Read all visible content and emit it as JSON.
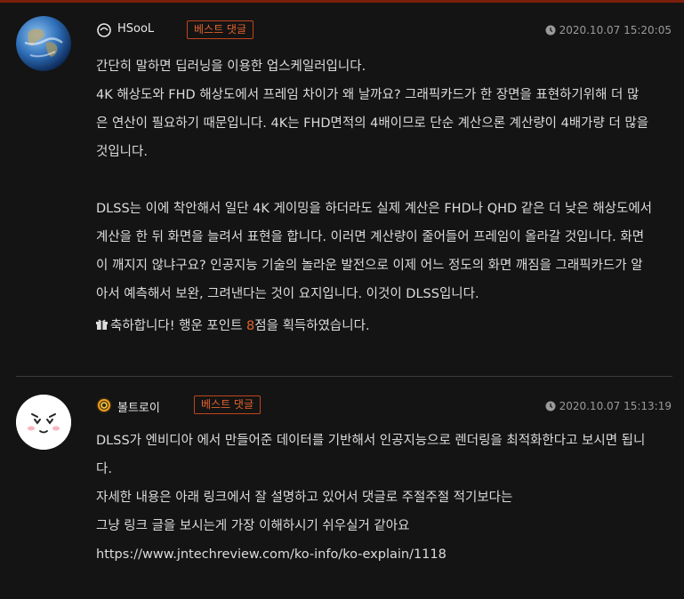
{
  "comments": [
    {
      "nickname": "HSooL",
      "badge": "베스트 댓글",
      "date": "2020.10.07 15:20:05",
      "lines": [
        "간단히 말하면 딥러닝을 이용한 업스케일러입니다.",
        "4K 해상도와 FHD 해상도에서 프레임 차이가 왜 날까요? 그래픽카드가 한 장면을 표현하기위해 더 많",
        "은 연산이 필요하기 때문입니다. 4K는 FHD면적의 4배이므로 단순 계산으론 계산량이 4배가량 더 많을",
        "것입니다.",
        "DLSS는 이에 착안해서 일단 4K 게이밍을 하더라도 실제 계산은 FHD나 QHD 같은 더 낮은 해상도에서",
        "계산을 한 뒤 화면을 늘려서 표현을 합니다. 이러면 계산량이 줄어들어 프레임이 올라갈 것입니다. 화면",
        "이 깨지지 않냐구요? 인공지능 기술의 놀라운 발전으로 이제 어느 정도의 화면 깨짐을 그래픽카드가 알",
        "아서 예측해서 보완, 그려낸다는 것이 요지입니다. 이것이 DLSS입니다."
      ],
      "reward_prefix": "축하합니다! 행운 포인트 ",
      "reward_points": "8",
      "reward_suffix": "점을 획득하였습니다."
    },
    {
      "nickname": "볼트로이",
      "badge": "베스트 댓글",
      "date": "2020.10.07 15:13:19",
      "lines": [
        "DLSS가 엔비디아 에서 만들어준 데이터를 기반해서 인공지능으로 렌더링을 최적화한다고 보시면 됩니",
        "다.",
        "자세한 내용은 아래 링크에서 잘 설명하고 있어서 댓글로 주절주절 적기보다는",
        "그냥 링크 글을 보시는게 가장 이해하시기 쉬우실거 같아요",
        "https://www.jntechreview.com/ko-info/ko-explain/1118"
      ]
    }
  ]
}
